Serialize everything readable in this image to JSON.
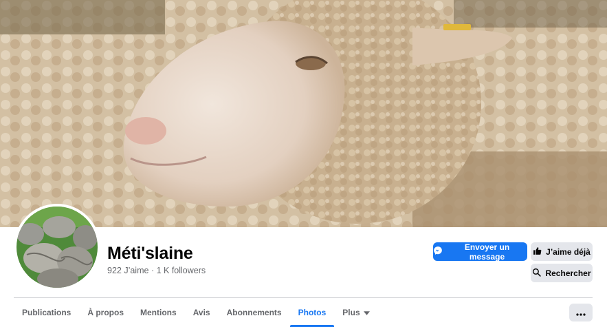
{
  "page": {
    "name": "Méti'slaine",
    "likes": "922 J’aime",
    "separator": "·",
    "followers": "1 K followers"
  },
  "actions": {
    "message": "Envoyer un message",
    "like": "J’aime déjà",
    "search": "Rechercher"
  },
  "tabs": [
    {
      "label": "Publications",
      "active": false
    },
    {
      "label": "À propos",
      "active": false
    },
    {
      "label": "Mentions",
      "active": false
    },
    {
      "label": "Avis",
      "active": false
    },
    {
      "label": "Abonnements",
      "active": false
    },
    {
      "label": "Photos",
      "active": true
    },
    {
      "label": "Plus",
      "active": false
    }
  ],
  "icons": {
    "messenger": "messenger-icon",
    "like": "thumbs-up-icon",
    "search": "search-icon",
    "plus_dropdown": "caret-down-icon",
    "more": "ellipsis-icon"
  },
  "colors": {
    "accent": "#1877f2",
    "secondary_button": "#e4e6eb",
    "muted_text": "#65676b"
  }
}
